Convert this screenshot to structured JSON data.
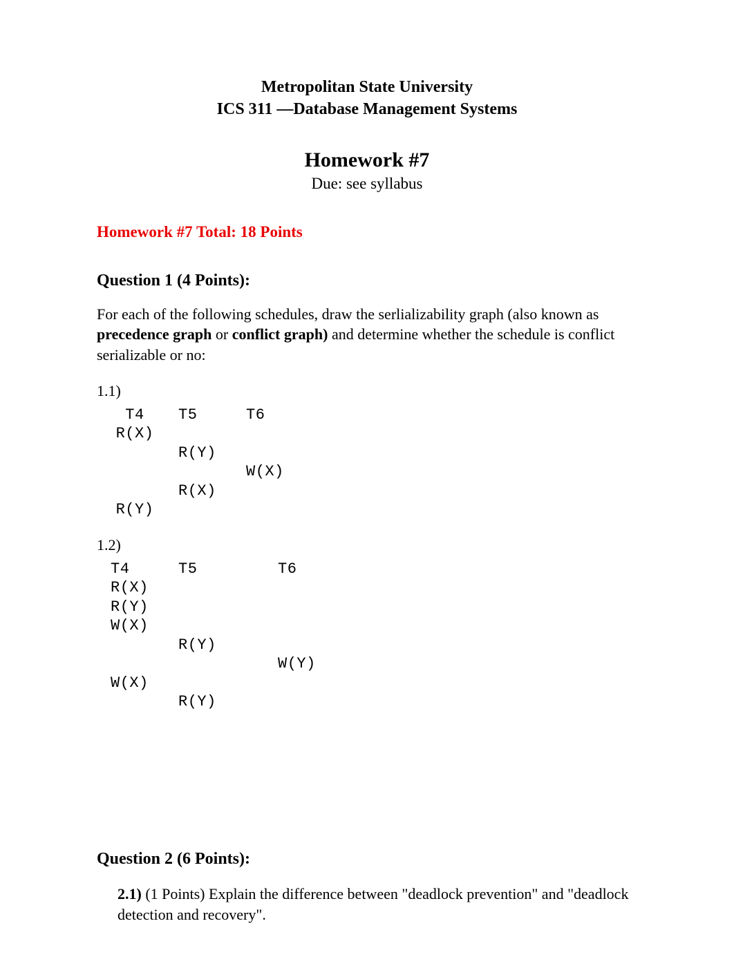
{
  "header": {
    "line1": "Metropolitan State University",
    "line2": "ICS 311 —Database Management Systems"
  },
  "title": "Homework #7",
  "due": "Due: see syllabus",
  "total": "Homework #7 Total: 18 Points",
  "q1": {
    "heading": "Question 1 (4 Points):",
    "intro_a": "For each of the following schedules, draw the serlializability graph (also known as ",
    "intro_b_bold": "precedence graph",
    "intro_c": " or ",
    "intro_d_bold": "conflict graph)",
    "intro_e": " and determine whether the schedule is conflict serializable or no:",
    "sub1_label": "1.1)",
    "sched1": {
      "h1": "T4",
      "h2": "T5",
      "h3": "T6",
      "r1c1": "R(X)",
      "r1c2": "",
      "r1c3": "",
      "r2c1": "",
      "r2c2": "R(Y)",
      "r2c3": "",
      "r3c1": "",
      "r3c2": "",
      "r3c3": "W(X)",
      "r4c1": "",
      "r4c2": "R(X)",
      "r4c3": "",
      "r5c1": "R(Y)",
      "r5c2": "",
      "r5c3": ""
    },
    "sub2_label": "1.2)",
    "sched2": {
      "h1": "T4",
      "h2": "T5",
      "h3": "T6",
      "r1c1": "R(X)",
      "r1c2": "",
      "r1c3": "",
      "r2c1": "R(Y)",
      "r2c2": "",
      "r2c3": "",
      "r3c1": "W(X)",
      "r3c2": "",
      "r3c3": "",
      "r4c1": "",
      "r4c2": "R(Y)",
      "r4c3": "",
      "r5c1": "",
      "r5c2": "",
      "r5c3": "W(Y)",
      "r6c1": "W(X)",
      "r6c2": "",
      "r6c3": "",
      "r7c1": "",
      "r7c2": "R(Y)",
      "r7c3": ""
    }
  },
  "q2": {
    "heading": "Question 2 (6 Points):",
    "sub_label_bold": "2.1)",
    "sub_text": "  (1 Points) Explain the difference between \"deadlock prevention\" and \"deadlock detection and recovery\"."
  }
}
